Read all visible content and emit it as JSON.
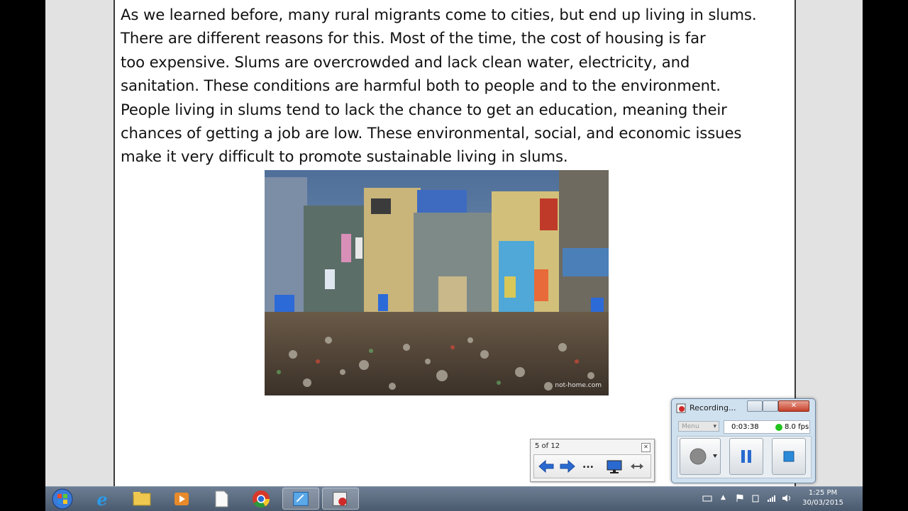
{
  "document": {
    "paragraph_lines": [
      "As we learned before, many rural migrants come to cities, but end up living in slums.",
      "There are different reasons for this.  Most of the time, the cost of housing is far",
      "too expensive.  Slums are overcrowded and lack clean water, electricity, and",
      "sanitation.  These conditions are harmful both to people and to the environment.",
      "People living in slums tend to lack the chance to get an education, meaning their",
      "chances of getting a job are low.  These environmental, social, and economic issues",
      "make it very difficult to promote sustainable living in slums."
    ],
    "image_watermark": "not-home.com"
  },
  "slide_nav": {
    "counter": "5 of 12",
    "close_glyph": "✕",
    "more_label": "..."
  },
  "recorder": {
    "title": "Recording...",
    "menu_label": "Menu",
    "elapsed": "0:03:38",
    "fps": "8.0 fps"
  },
  "taskbar": {
    "time": "1:25 PM",
    "date": "30/03/2015"
  }
}
